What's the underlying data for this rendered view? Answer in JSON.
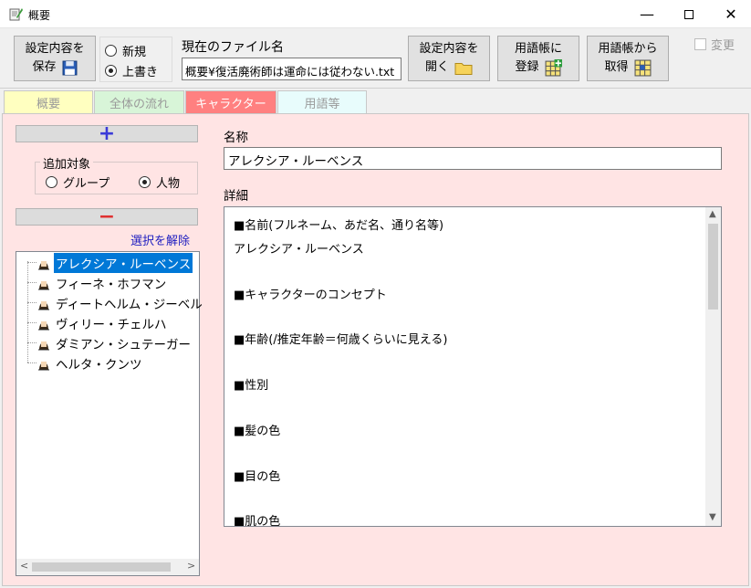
{
  "window": {
    "title": "概要",
    "icon": "app-notebook-icon"
  },
  "toolbar": {
    "save_line1": "設定内容を",
    "save_line2": "保存",
    "save_icon": "floppy-disk-icon",
    "radio_new": "新規",
    "radio_overwrite": "上書き",
    "radio_selected": "上書き",
    "file_label": "現在のファイル名",
    "file_value": "概要¥復活廃術師は運命には従わない.txt",
    "open_line1": "設定内容を",
    "open_line2": "開く",
    "open_icon": "folder-icon",
    "register_line1": "用語帳に",
    "register_line2": "登録",
    "register_icon": "grid-add-icon",
    "fetch_line1": "用語帳から",
    "fetch_line2": "取得",
    "fetch_icon": "grid-fetch-icon",
    "changed_label": "変更",
    "changed_checked": false
  },
  "tabs": [
    {
      "label": "概要",
      "color": "#ffffc0"
    },
    {
      "label": "全体の流れ",
      "color": "#d8f5d8"
    },
    {
      "label": "キャラクター",
      "color": "#ff8080"
    },
    {
      "label": "用語等",
      "color": "#e8fcfc"
    }
  ],
  "active_tab": "キャラクター",
  "left": {
    "add_symbol": "+",
    "add_target_label": "追加対象",
    "radio_group": "グループ",
    "radio_person": "人物",
    "radio_selected": "人物",
    "remove_symbol": "−",
    "deselect_label": "選択を解除",
    "characters": [
      "アレクシア・ルーベンス",
      "フィーネ・ホフマン",
      "ディートヘルム・ジーベル",
      "ヴィリー・チェルハ",
      "ダミアン・シュテーガー",
      "ヘルタ・クンツ"
    ],
    "selected_character": "アレクシア・ルーベンス"
  },
  "right": {
    "name_label": "名称",
    "name_value": "アレクシア・ルーベンス",
    "detail_label": "詳細",
    "detail_lines": [
      "■名前(フルネーム、あだ名、通り名等)",
      "アレクシア・ルーベンス",
      "",
      "■キャラクターのコンセプト",
      "",
      "■年齢(/推定年齢＝何歳くらいに見える)",
      "",
      "■性別",
      "",
      "■髪の色",
      "",
      "■目の色",
      "",
      "■肌の色"
    ]
  }
}
